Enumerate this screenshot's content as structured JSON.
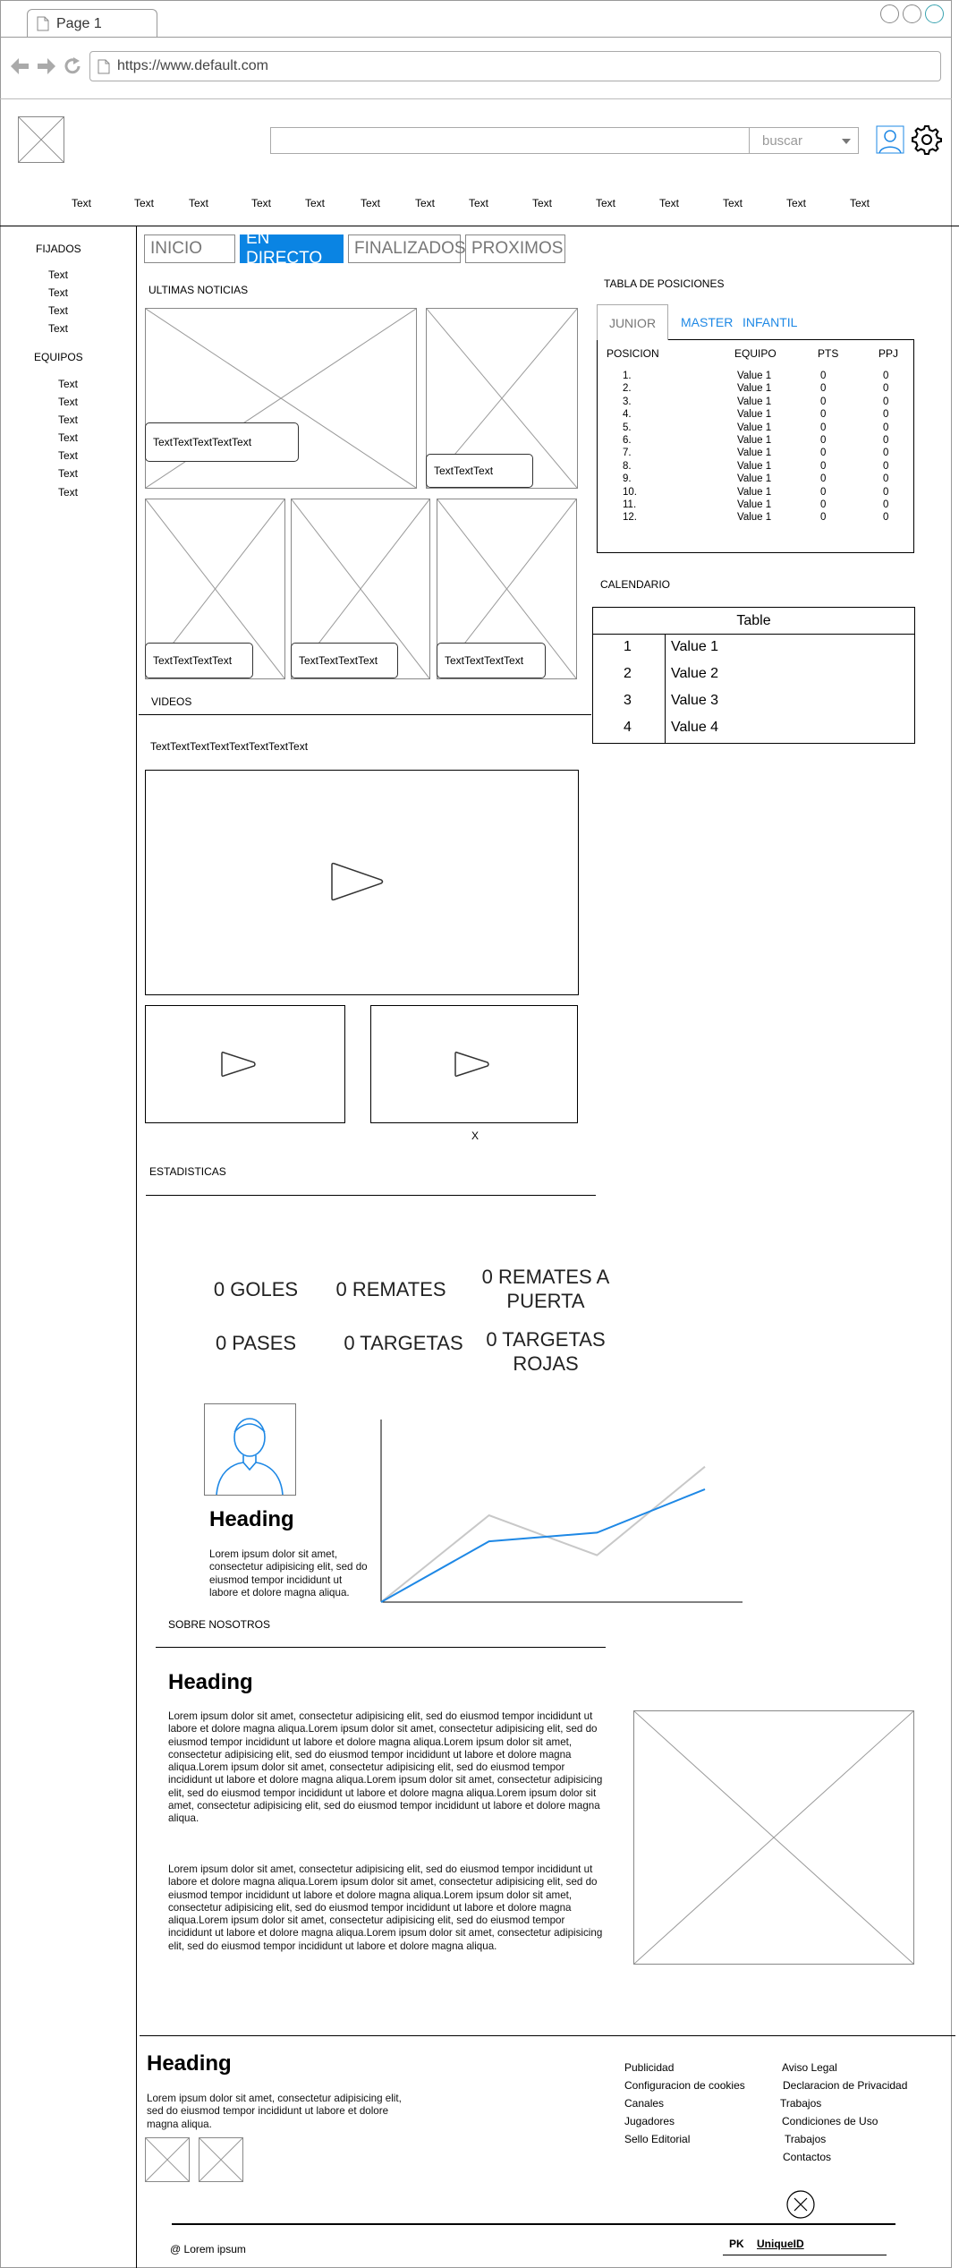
{
  "browser": {
    "tab_title": "Page 1",
    "url": "https://www.default.com"
  },
  "header": {
    "search_placeholder": "",
    "search_dropdown": "buscar",
    "nav_items": [
      "Text",
      "Text",
      "Text",
      "Text",
      "Text",
      "Text",
      "Text",
      "Text",
      "Text",
      "Text",
      "Text",
      "Text",
      "Text",
      "Text"
    ]
  },
  "sidebar": {
    "pinned_title": "FIJADOS",
    "pinned_items": [
      "Text",
      "Text",
      "Text",
      "Text"
    ],
    "teams_title": "EQUIPOS",
    "team_items": [
      "Text",
      "Text",
      "Text",
      "Text",
      "Text",
      "Text",
      "Text"
    ]
  },
  "tabs": [
    {
      "label": "INICIO",
      "active": false
    },
    {
      "label": "EN DIRECTO",
      "active": true
    },
    {
      "label": "FINALIZADOS",
      "active": false
    },
    {
      "label": "PROXIMOS",
      "active": false
    }
  ],
  "news": {
    "title": "ULTIMAS NOTICIAS",
    "captions": [
      "TextTextTextTextText",
      "TextTextText",
      "TextTextTextText",
      "TextTextTextText",
      "TextTextTextText"
    ]
  },
  "videos": {
    "title": "VIDEOS",
    "caption": "TextTextTextTextTextTextTextText",
    "x_label": "X"
  },
  "standings": {
    "title": "TABLA DE POSICIONES",
    "tabs": [
      "JUNIOR",
      "MASTER",
      "INFANTIL"
    ],
    "headers": [
      "POSICION",
      "EQUIPO",
      "PTS",
      "PPJ"
    ],
    "rows": [
      [
        "1.",
        "Value 1",
        "0",
        "0"
      ],
      [
        "2.",
        "Value 1",
        "0",
        "0"
      ],
      [
        "3.",
        "Value 1",
        "0",
        "0"
      ],
      [
        "4.",
        "Value 1",
        "0",
        "0"
      ],
      [
        "5.",
        "Value 1",
        "0",
        "0"
      ],
      [
        "6.",
        "Value 1",
        "0",
        "0"
      ],
      [
        "7.",
        "Value 1",
        "0",
        "0"
      ],
      [
        "8.",
        "Value 1",
        "0",
        "0"
      ],
      [
        "9.",
        "Value 1",
        "0",
        "0"
      ],
      [
        "10.",
        "Value 1",
        "0",
        "0"
      ],
      [
        "11.",
        "Value 1",
        "0",
        "0"
      ],
      [
        "12.",
        "Value 1",
        "0",
        "0"
      ]
    ]
  },
  "calendar": {
    "title": "CALENDARIO",
    "table_title": "Table",
    "rows": [
      [
        "1",
        "Value 1"
      ],
      [
        "2",
        "Value 2"
      ],
      [
        "3",
        "Value 3"
      ],
      [
        "4",
        "Value 4"
      ]
    ]
  },
  "stats": {
    "title": "ESTADISTICAS",
    "items": [
      "0 GOLES",
      "0 REMATES",
      "0 REMATES A PUERTA",
      "0 PASES",
      "0 TARGETAS",
      "0 TARGETAS ROJAS"
    ],
    "profile_heading": "Heading",
    "profile_text": "Lorem ipsum dolor sit amet, consectetur adipisicing elit, sed do eiusmod tempor incididunt ut labore et dolore magna aliqua."
  },
  "chart_data": {
    "type": "line",
    "x": [
      0,
      1,
      2,
      3
    ],
    "series": [
      {
        "color": "#1e88e5",
        "values": [
          0,
          35,
          40,
          65
        ]
      },
      {
        "color": "#c8c8c8",
        "values": [
          0,
          50,
          27,
          78
        ]
      }
    ],
    "ylim": [
      0,
      100
    ]
  },
  "about": {
    "title": "SOBRE NOSOTROS",
    "heading": "Heading",
    "paragraph1": "Lorem ipsum dolor sit amet, consectetur adipisicing elit, sed do eiusmod tempor incididunt ut labore et dolore magna aliqua.Lorem ipsum dolor sit amet, consectetur adipisicing elit, sed do eiusmod tempor incididunt ut labore et dolore magna aliqua.Lorem ipsum dolor sit amet, consectetur adipisicing elit, sed do eiusmod tempor incididunt ut labore et dolore magna aliqua.Lorem ipsum dolor sit amet, consectetur adipisicing elit, sed do eiusmod tempor incididunt ut labore et dolore magna aliqua.Lorem ipsum dolor sit amet, consectetur adipisicing elit, sed do eiusmod tempor incididunt ut labore et dolore magna aliqua.Lorem ipsum dolor sit amet, consectetur adipisicing elit, sed do eiusmod tempor incididunt ut labore et dolore magna aliqua.",
    "paragraph2": "Lorem ipsum dolor sit amet, consectetur adipisicing elit, sed do eiusmod tempor incididunt ut labore et dolore magna aliqua.Lorem ipsum dolor sit amet, consectetur adipisicing elit, sed do eiusmod tempor incididunt ut labore et dolore magna aliqua.Lorem ipsum dolor sit amet, consectetur adipisicing elit, sed do eiusmod tempor incididunt ut labore et dolore magna aliqua.Lorem ipsum dolor sit amet, consectetur adipisicing elit, sed do eiusmod tempor incididunt ut labore et dolore magna aliqua.Lorem ipsum dolor sit amet, consectetur adipisicing elit, sed do eiusmod tempor incididunt ut labore et dolore magna aliqua."
  },
  "footer": {
    "heading": "Heading",
    "text": "Lorem ipsum dolor sit amet, consectetur adipisicing elit, sed do eiusmod tempor incididunt ut labore et dolore magna aliqua.",
    "links_col1": [
      "Publicidad",
      "Configuracion de cookies",
      "Canales",
      "Jugadores",
      "Sello Editorial"
    ],
    "links_col2": [
      "Aviso Legal",
      "Declaracion de Privacidad",
      "Trabajos",
      "Condiciones de Uso",
      "Trabajos",
      "Contactos"
    ],
    "copyright": "@ Lorem ipsum",
    "pk_label": "PK",
    "pk_value": "UniqueID"
  },
  "colors": {
    "accent": "#0a84e3",
    "link": "#1e88e5"
  }
}
